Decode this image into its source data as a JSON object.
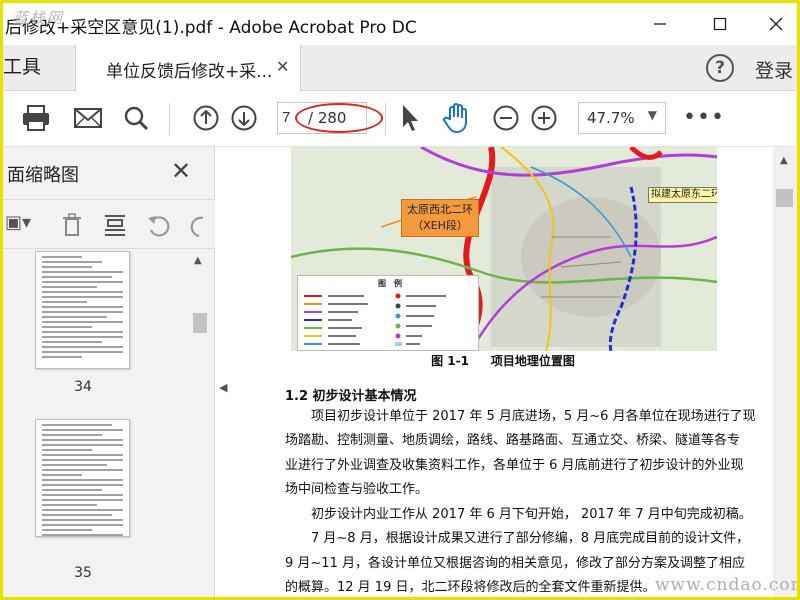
{
  "window": {
    "title": "后修改+采空区意见(1).pdf - Adobe Acrobat Pro DC",
    "watermark_top": "蓝栈网",
    "accent_border": "#e6e200"
  },
  "tabbar": {
    "tools_label": "工具",
    "doc_tab_label": "单位反馈后修改+采...",
    "help_symbol": "?",
    "login_label": "登录"
  },
  "toolbar": {
    "current_page": "7",
    "total_pages": "/ 280",
    "zoom": "47.7%",
    "highlight_color": "#e0261d"
  },
  "left_panel": {
    "title": "面缩略图",
    "thumbnails": [
      {
        "page": "34"
      },
      {
        "page": "35"
      }
    ]
  },
  "document": {
    "map_callout": "太原西北二环\n（XEH段）",
    "map_callout_line1": "太原西北二环",
    "map_callout_line2": "（XEH段）",
    "map_callout2": "拟建太原东二环",
    "legend_title": "图　例",
    "figure_number": "图 1-1",
    "figure_title": "项目地理位置图",
    "section_heading": "1.2 初步设计基本情况",
    "paragraphs": [
      "　　项目初步设计单位于 2017 年 5 月底进场，5 月~6 月各单位在现场进行了现",
      "场踏勘、控制测量、地质调绘，路线、路基路面、互通立交、桥梁、隧道等各专",
      "业进行了外业调查及收集资料工作，各单位于 6 月底前进行了初步设计的外业现",
      "场中间检查与验收工作。",
      "　　初步设计内业工作从 2017 年 6 月下旬开始，  2017 年 7 月中旬完成初稿。",
      "　　7 月~8 月，根据设计成果又进行了部分修编，8 月底完成目前的设计文件，",
      "9 月~11 月，各设计单位又根据咨询的相关意见，修改了部分方案及调整了相应",
      "的概算。12 月 19 日，北二环段将修改后的全套文件重新提供。"
    ]
  },
  "watermark_bottom": "www.cndao.com"
}
